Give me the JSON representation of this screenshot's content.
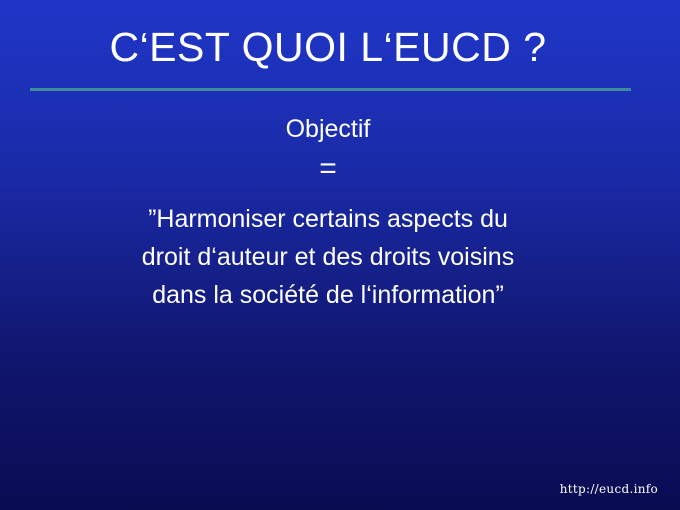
{
  "slide": {
    "title": "C‘EST QUOI L‘EUCD ?",
    "subtitle": "Objectif",
    "equals_sign": "=",
    "quote_lines": [
      "”Harmoniser certains aspects du",
      "droit d‘auteur et des droits voisins",
      "dans la société de l‘information”"
    ],
    "footer_url": "http://eucd.info"
  },
  "colors": {
    "background_top": "#1f36c8",
    "background_bottom": "#0a0c52",
    "rule": "#3e8aa0",
    "text": "#ffffff"
  }
}
